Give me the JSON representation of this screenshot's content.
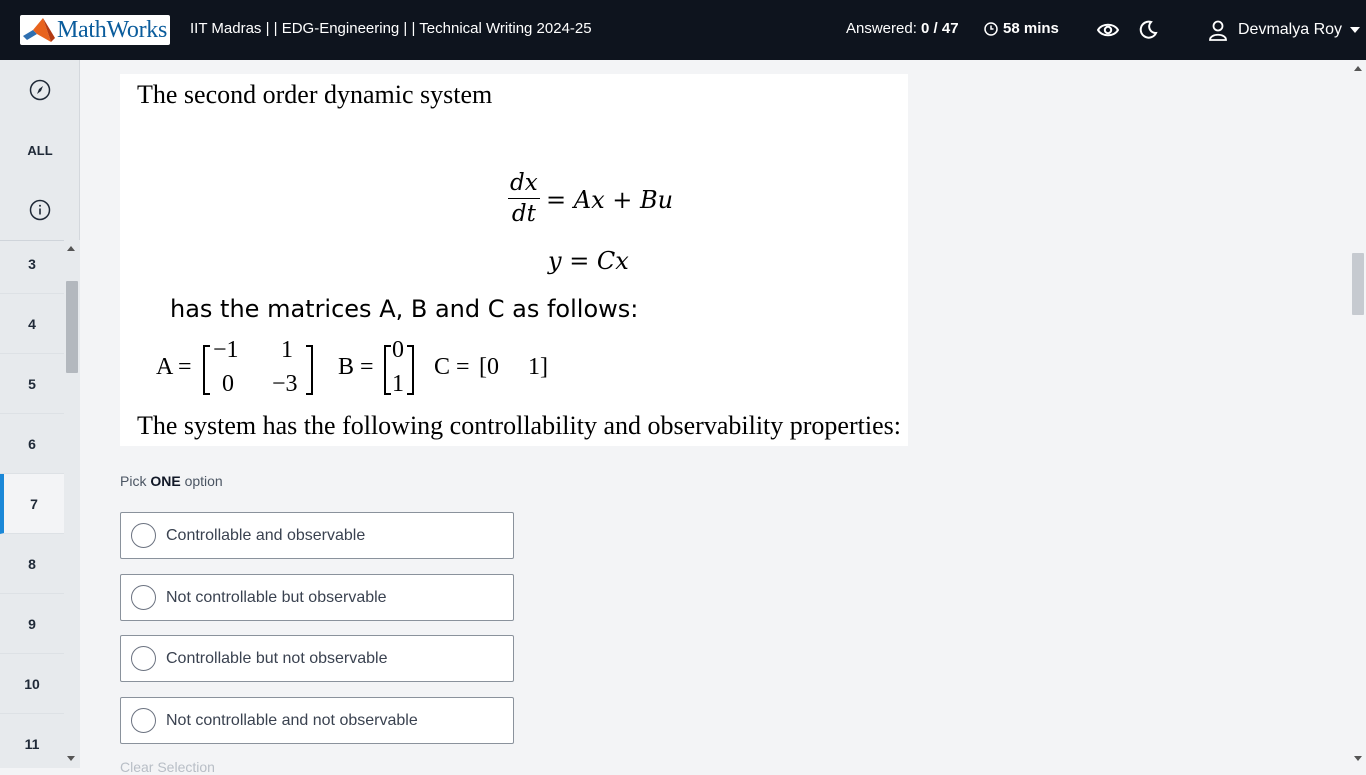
{
  "header": {
    "logo_text": "MathWorks",
    "course_title": "IIT Madras | | EDG-Engineering | | Technical Writing 2024-25",
    "answered_label": "Answered:",
    "answered_value": "0 / 47",
    "time_left": "58 mins",
    "user_name": "Devmalya Roy",
    "icons": [
      "clock-icon",
      "eye-icon",
      "moon-icon",
      "user-icon",
      "caret-down-icon"
    ]
  },
  "sidebar": {
    "top_buttons": [
      {
        "icon": "compass-icon"
      },
      {
        "label": "ALL"
      },
      {
        "icon": "info-icon"
      }
    ],
    "questions": [
      "3",
      "4",
      "5",
      "6",
      "7",
      "8",
      "9",
      "10",
      "11"
    ],
    "active_question": "7",
    "accent_color": "#1b88d8"
  },
  "question": {
    "intro": "The second order dynamic system",
    "eq_frac_num": "dx",
    "eq_frac_den": "dt",
    "eq_rhs": "= Ax + Bu",
    "eq2": "y = Cx",
    "matrices_intro": "has the matrices A, B and C as follows:",
    "matrix_A_label": "A =",
    "matrix_A": [
      "−1",
      "1",
      "0",
      "−3"
    ],
    "matrix_B_label": "B =",
    "matrix_B": [
      "0",
      "1"
    ],
    "matrix_C_label": "C =",
    "matrix_C": [
      "[0",
      "1]"
    ],
    "outro": "The system has the following controllability and observability properties:"
  },
  "answers": {
    "pick_prefix": "Pick",
    "pick_bold": "ONE",
    "pick_suffix": "option",
    "options": [
      "Controllable and observable",
      "Not controllable but observable",
      "Controllable but not observable",
      "Not controllable and not observable"
    ],
    "clear_label": "Clear Selection"
  }
}
